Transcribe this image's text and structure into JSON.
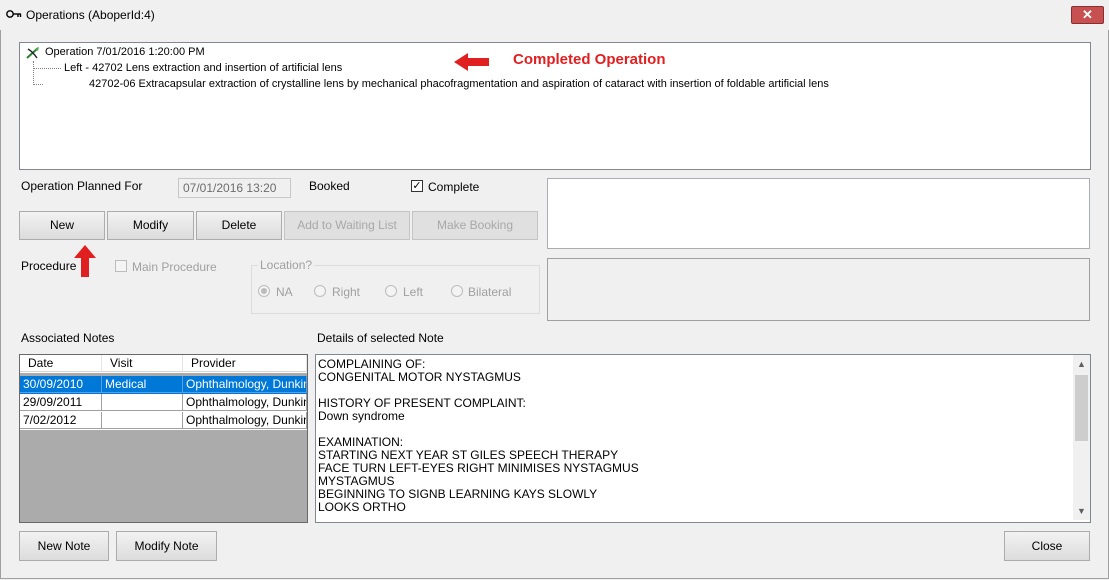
{
  "window": {
    "title": "Operations (AboperId:4)"
  },
  "tree": {
    "root": "Operation 7/01/2016 1:20:00 PM",
    "child1": "Left  - 42702  Lens extraction and insertion of artificial lens",
    "child2": "42702-06  Extracapsular extraction of crystalline lens by mechanical phacofragmentation and aspiration of cataract with insertion of foldable artificial lens"
  },
  "annotations": {
    "completed": "Completed Operation"
  },
  "form": {
    "planned_label": "Operation Planned For",
    "planned_value": "07/01/2016 13:20",
    "booked_label": "Booked",
    "complete_label": "Complete",
    "complete_checked": "✓",
    "procedure_label": "Procedure",
    "main_procedure_label": "Main Procedure",
    "location_label": "Location?",
    "location_options": [
      "NA",
      "Right",
      "Left",
      "Bilateral"
    ],
    "location_selected": "NA"
  },
  "buttons": {
    "new": "New",
    "modify": "Modify",
    "delete": "Delete",
    "add_waiting": "Add to Waiting List",
    "make_booking": "Make Booking",
    "new_note": "New Note",
    "modify_note": "Modify Note",
    "close": "Close"
  },
  "notes_section": {
    "associated_label": "Associated Notes",
    "details_label": "Details of selected Note",
    "columns": [
      "Date",
      "Visit",
      "Provider"
    ],
    "rows": [
      {
        "date": "30/09/2010",
        "visit": "Medical",
        "provider": "Ophthalmology, Dunkin"
      },
      {
        "date": "29/09/2011",
        "visit": "",
        "provider": "Ophthalmology, Dunkin"
      },
      {
        "date": "7/02/2012",
        "visit": "",
        "provider": "Ophthalmology, Dunkin"
      }
    ],
    "details_lines": [
      "COMPLAINING OF:",
      "CONGENITAL MOTOR NYSTAGMUS",
      "",
      "HISTORY OF PRESENT COMPLAINT:",
      "Down syndrome",
      "",
      "EXAMINATION:",
      "STARTING NEXT YEAR ST GILES SPEECH THERAPY",
      "FACE TURN LEFT-EYES RIGHT MINIMISES NYSTAGMUS",
      "MYSTAGMUS",
      "BEGINNING TO SIGNB LEARNING KAYS SLOWLY",
      "LOOKS ORTHO"
    ]
  },
  "colors": {
    "annotation": "#e02020",
    "selection": "#0078d7"
  },
  "icons": {
    "window_icon": "key-icon",
    "tree_icon": "operation-leaf-icon"
  }
}
